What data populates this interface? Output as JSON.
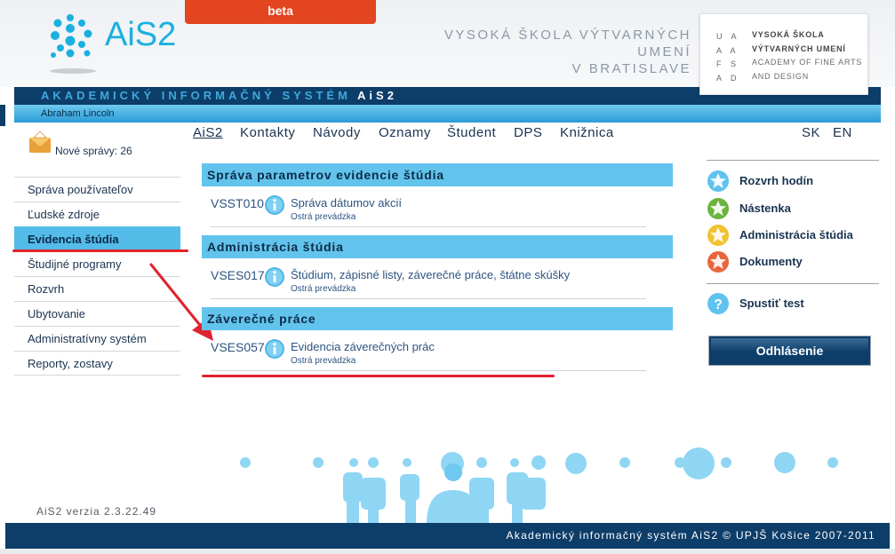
{
  "header": {
    "logo_text": "AiS2",
    "beta_label": "beta",
    "school_line1": "VYSOKÁ ŠKOLA VÝTVARNÝCH UMENÍ",
    "school_line2": "V BRATISLAVE",
    "vsvu_letters": [
      "U",
      "A",
      "F",
      "S",
      "A",
      "D"
    ],
    "vsvu_line1": "VYSOKÁ ŠKOLA",
    "vsvu_line2": "VÝTVARNÝCH UMENÍ",
    "vsvu_line3": "ACADEMY OF FINE ARTS",
    "vsvu_line4": "AND DESIGN"
  },
  "band": {
    "title": "AKADEMICKÝ INFORMAČNÝ SYSTÉM",
    "title_highlight": "AiS2",
    "user_name": "Abraham Lincoln"
  },
  "inbox": {
    "label": "Nové správy: 26"
  },
  "left_nav": {
    "items": [
      "Správa používateľov",
      "Ľudské zdroje",
      "Evidencia štúdia",
      "Študijné programy",
      "Rozvrh",
      "Ubytovanie",
      "Administratívny systém",
      "Reporty, zostavy"
    ],
    "active_index": 2
  },
  "top_nav": {
    "links": [
      "AiS2",
      "Kontakty",
      "Návody",
      "Oznamy",
      "Študent",
      "DPS",
      "Knižnica"
    ],
    "languages": [
      "SK",
      "EN"
    ]
  },
  "sections": [
    {
      "title": "Správa parametrov evidencie štúdia",
      "apps": [
        {
          "code": "VSST010",
          "name": "Správa dátumov akcií",
          "env": "Ostrá prevádzka"
        }
      ]
    },
    {
      "title": "Administrácia štúdia",
      "apps": [
        {
          "code": "VSES017",
          "name": "Štúdium, zápisné listy, záverečné práce, štátne skúšky",
          "env": "Ostrá prevádzka"
        }
      ]
    },
    {
      "title": "Záverečné práce",
      "apps": [
        {
          "code": "VSES057",
          "name": "Evidencia záverečných prác",
          "env": "Ostrá prevádzka"
        }
      ]
    }
  ],
  "right_col": {
    "links": [
      {
        "label": "Rozvrh hodín",
        "icon": "star-icon",
        "color": "#5ec3ee"
      },
      {
        "label": "Nástenka",
        "icon": "star-icon",
        "color": "#6db33f"
      },
      {
        "label": "Administrácia štúdia",
        "icon": "star-icon",
        "color": "#f2c230"
      },
      {
        "label": "Dokumenty",
        "icon": "star-icon",
        "color": "#e8663c"
      }
    ],
    "test_label": "Spustiť test",
    "logout_label": "Odhlásenie"
  },
  "version": "AiS2 verzia 2.3.22.49",
  "footer": "Akademický informačný systém AiS2 © UPJŠ Košice 2007-2011",
  "colors": {
    "brand_dark": "#0d3d69",
    "brand_light": "#54bce8",
    "beta": "#e2451f",
    "highlight_red": "#e0232e"
  }
}
